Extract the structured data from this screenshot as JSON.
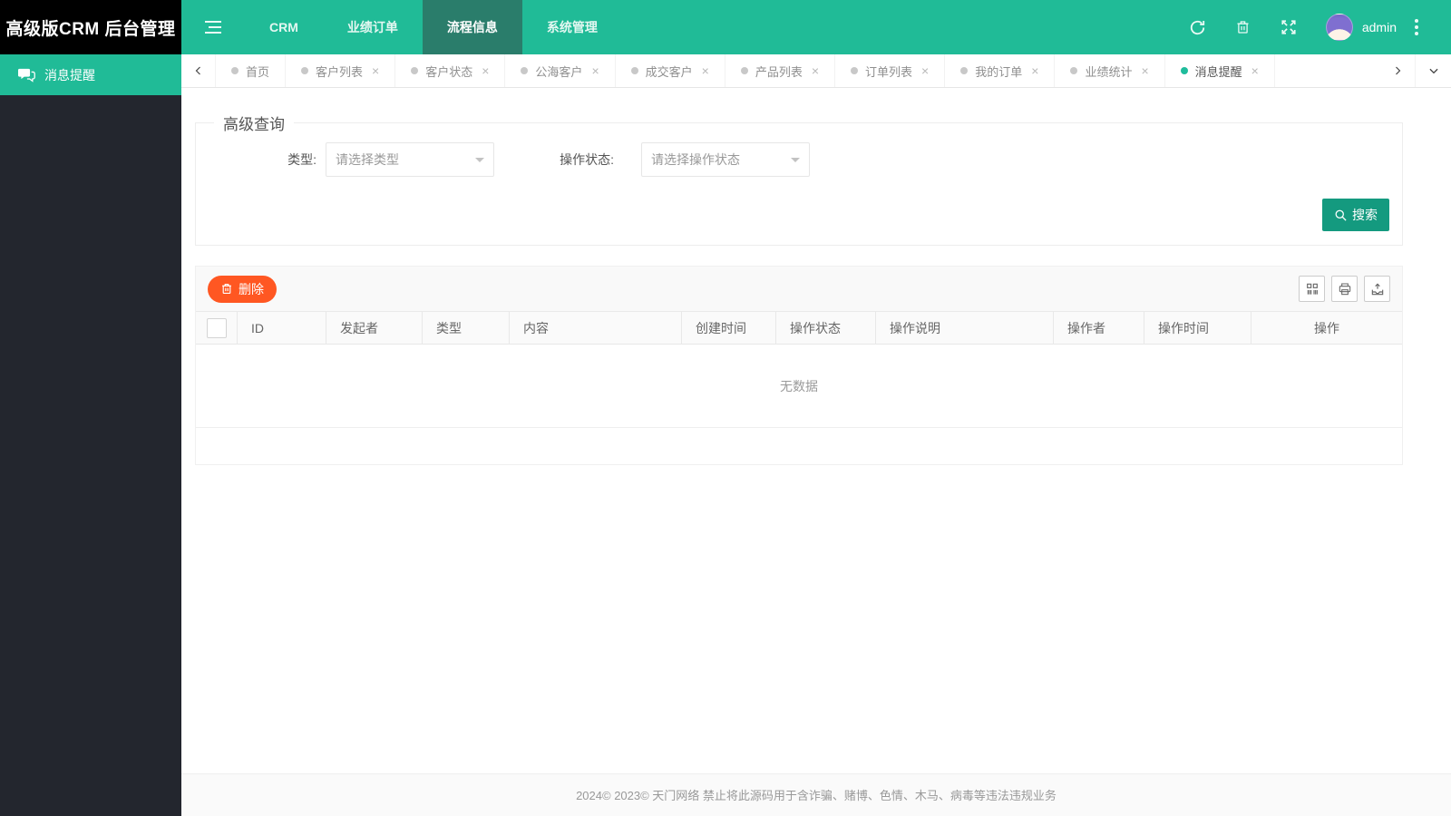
{
  "app": {
    "logo_title": "高级版CRM 后台管理"
  },
  "topnav": {
    "items": [
      {
        "label": "CRM"
      },
      {
        "label": "业绩订单"
      },
      {
        "label": "流程信息",
        "active": true
      },
      {
        "label": "系统管理"
      }
    ],
    "username": "admin"
  },
  "sidebar": {
    "items": [
      {
        "label": "消息提醒",
        "active": true
      }
    ]
  },
  "tabbar": {
    "close_glyph": "×",
    "tabs": [
      {
        "label": "首页",
        "closable": false
      },
      {
        "label": "客户列表",
        "closable": true
      },
      {
        "label": "客户状态",
        "closable": true
      },
      {
        "label": "公海客户",
        "closable": true
      },
      {
        "label": "成交客户",
        "closable": true
      },
      {
        "label": "产品列表",
        "closable": true
      },
      {
        "label": "订单列表",
        "closable": true
      },
      {
        "label": "我的订单",
        "closable": true
      },
      {
        "label": "业绩统计",
        "closable": true
      },
      {
        "label": "消息提醒",
        "closable": true,
        "active": true
      }
    ]
  },
  "search_panel": {
    "legend": "高级查询",
    "type_label": "类型:",
    "type_placeholder": "请选择类型",
    "status_label": "操作状态:",
    "status_placeholder": "请选择操作状态",
    "search_label": "搜索"
  },
  "table_panel": {
    "delete_label": "删除",
    "columns": [
      "ID",
      "发起者",
      "类型",
      "内容",
      "创建时间",
      "操作状态",
      "操作说明",
      "操作者",
      "操作时间",
      "操作"
    ],
    "empty_text": "无数据"
  },
  "footer": {
    "text": "2024© 2023© 天门网络 禁止将此源码用于含诈骗、赌博、色情、木马、病毒等违法违规业务"
  },
  "icons": {
    "menu": "hamburger-bars",
    "refresh": "circular-arrows",
    "clear": "trash-outline",
    "fullscreen": "expand-arrows",
    "more": "vertical-dots",
    "message": "comment-bubbles",
    "search": "magnifier",
    "delete": "trash-outline",
    "columns": "grid-columns",
    "print": "printer",
    "export": "export-tray"
  },
  "colors": {
    "topbar": "#20bb97",
    "topbar_active": "#2a7d6b",
    "sidebar_bg": "#23262e",
    "sidebar_active": "#20bb97",
    "search_button": "#149a7f",
    "delete_button": "#ff5722",
    "active_tab_dot": "#1fbc9c",
    "logo_bg": "#000000"
  }
}
